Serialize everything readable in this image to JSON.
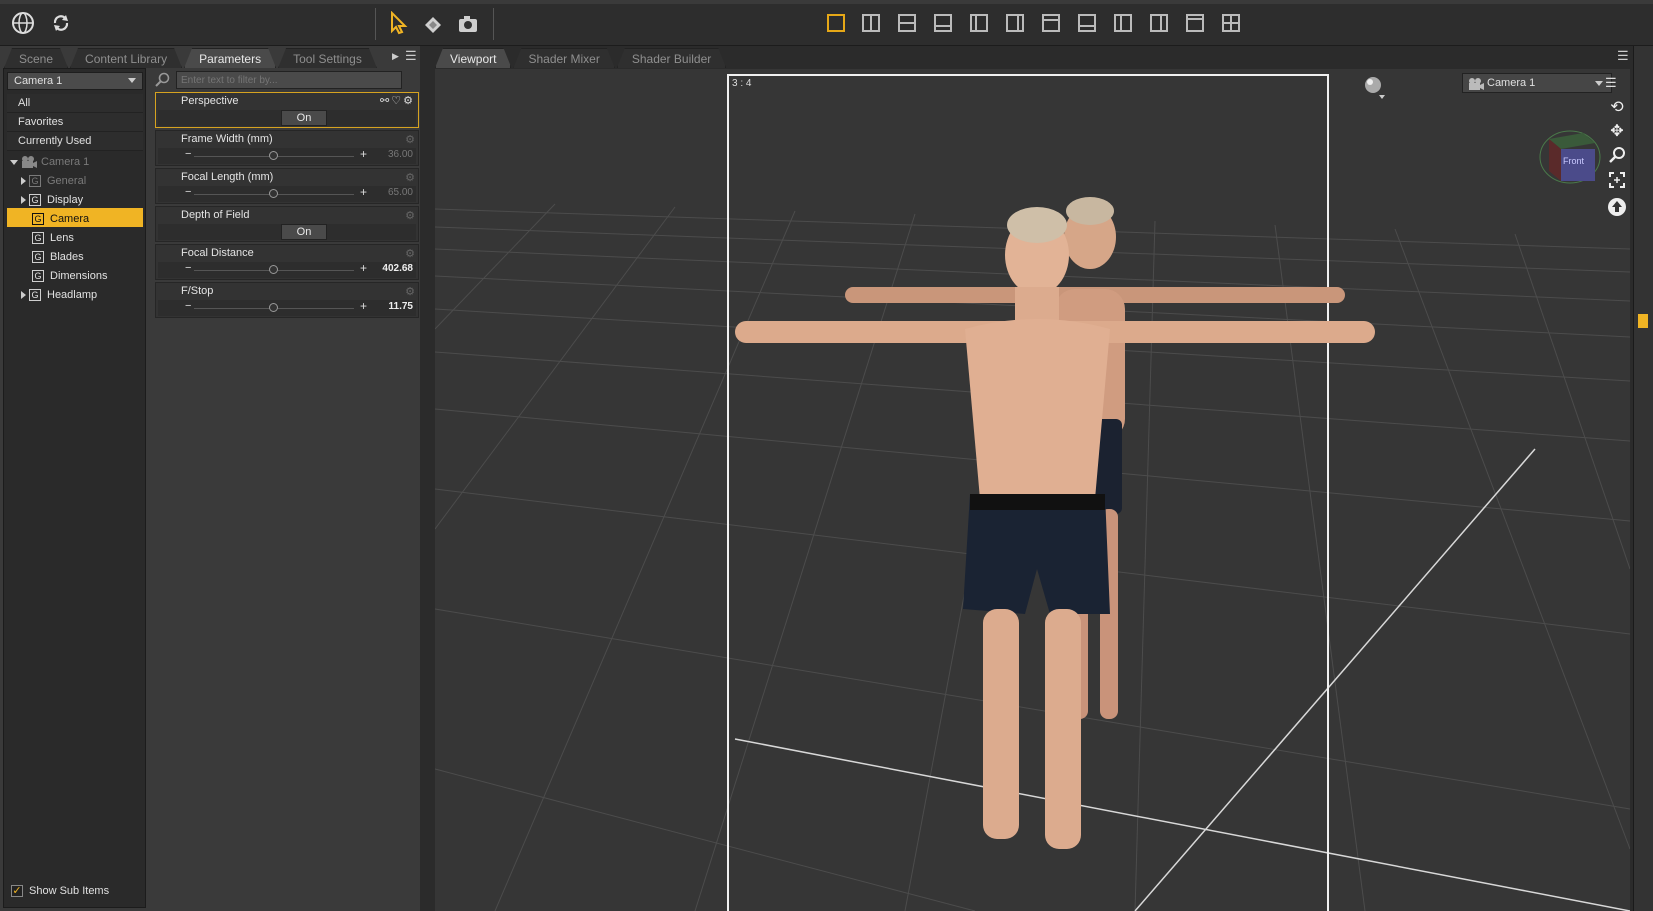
{
  "toolbar": {
    "icons": [
      "globe-icon",
      "refresh-icon",
      "pointer-tool-icon",
      "universal-tool-icon",
      "camera-tool-icon"
    ],
    "layout_buttons": 12,
    "accent": "#e6a817"
  },
  "left_panel": {
    "tabs": [
      "Scene",
      "Content Library",
      "Parameters",
      "Tool Settings"
    ],
    "active_tab": "Parameters",
    "node_selector": "Camera 1",
    "filters": [
      "All",
      "Favorites",
      "Currently Used"
    ],
    "tree": {
      "root": "Camera 1",
      "items": [
        {
          "label": "General",
          "expandable": true,
          "dim": true
        },
        {
          "label": "Display",
          "expandable": true,
          "dim": false
        },
        {
          "label": "Camera",
          "expandable": false,
          "selected": true
        },
        {
          "label": "Lens",
          "expandable": false
        },
        {
          "label": "Blades",
          "expandable": false
        },
        {
          "label": "Dimensions",
          "expandable": false
        },
        {
          "label": "Headlamp",
          "expandable": true
        }
      ]
    },
    "show_sub_items": "Show Sub Items",
    "search_placeholder": "Enter text to filter by...",
    "params": [
      {
        "label": "Perspective",
        "type": "toggle",
        "value": "On",
        "highlighted": true
      },
      {
        "label": "Frame Width (mm)",
        "type": "slider",
        "value": "36.00",
        "level": 0.5,
        "dim": true
      },
      {
        "label": "Focal Length (mm)",
        "type": "slider",
        "value": "65.00",
        "level": 0.5,
        "dim": true
      },
      {
        "label": "Depth of Field",
        "type": "toggle",
        "value": "On"
      },
      {
        "label": "Focal Distance",
        "type": "slider",
        "value": "402.68",
        "level": 0.5
      },
      {
        "label": "F/Stop",
        "type": "slider",
        "value": "11.75",
        "level": 0.5
      }
    ]
  },
  "viewport": {
    "tabs": [
      "Viewport",
      "Shader Mixer",
      "Shader Builder"
    ],
    "active_tab": "Viewport",
    "aspect_label": "3 : 4",
    "camera": "Camera 1",
    "cube_label": "Front",
    "nav_icons": [
      "orbit-icon",
      "pan-icon",
      "zoom-icon",
      "frame-icon",
      "reset-icon"
    ]
  }
}
